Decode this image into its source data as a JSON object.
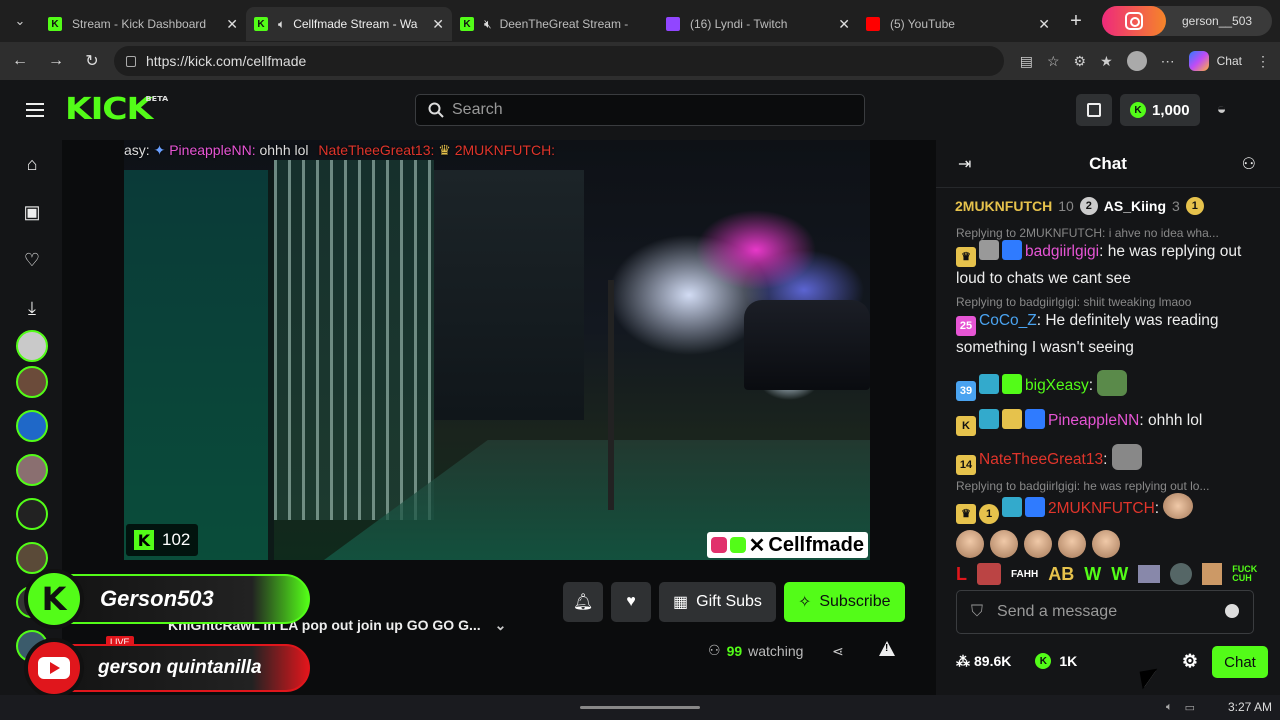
{
  "browser": {
    "tabs": [
      {
        "label": "Stream - Kick Dashboard",
        "favicon": "kick-icon",
        "color": "#53fc18",
        "active": false
      },
      {
        "label": "Cellfmade Stream - Wa",
        "favicon": "kick-icon",
        "color": "#53fc18",
        "active": true
      },
      {
        "label": "DeenTheGreat Stream -",
        "favicon": "kick-icon",
        "color": "#53fc18",
        "active": false
      },
      {
        "label": "(16) Lyndi - Twitch",
        "favicon": "twitch-icon",
        "color": "#9146ff",
        "active": false
      },
      {
        "label": "(5) YouTube",
        "favicon": "youtube-icon",
        "color": "#ff0000",
        "active": false
      }
    ],
    "profile_name": "gerson__503",
    "url": "https://kick.com/cellfmade",
    "copilot_label": "Chat"
  },
  "kick": {
    "logo": "KICK",
    "logo_beta": "BETA",
    "search_placeholder": "Search",
    "points": "1,000",
    "accent": "#53fc18"
  },
  "video": {
    "overlay_chat": {
      "lead": "asy:",
      "name1": "PineappleNN:",
      "text1": "ohhh lol",
      "name2": "NateTheeGreat13:",
      "name3": "2MUKNFUTCH:"
    },
    "viewer_count": "102",
    "watermark": "Cellfmade"
  },
  "stream": {
    "title": "KniGhtcRawL in LA pop out join up GO GO G...",
    "gift_label": "Gift Subs",
    "subscribe_label": "Subscribe",
    "watching_count": "99",
    "watching_label": "watching",
    "live_label": "LIVE"
  },
  "overlays": {
    "kick_name": "Gerson503",
    "youtube_name": "gerson quintanilla"
  },
  "chat": {
    "title": "Chat",
    "pinned": [
      {
        "name": "2MUKNFUTCH",
        "count": "10"
      },
      {
        "name": "AS_Kiing",
        "count": "3",
        "rank": "2"
      },
      {
        "rank": "1"
      }
    ],
    "messages": [
      {
        "reply": "Replying to 2MUKNFUTCH: i ahve no idea wha...",
        "user": "badgiirlgigi",
        "color": "#e655d4",
        "text": "he was replying out loud to chats we cant see"
      },
      {
        "reply": "Replying to badgiirlgigi: shiit tweaking lmaoo",
        "user": "CoCo_Z",
        "color": "#4aa3f0",
        "badge": "25",
        "text": "He definitely was reading something I wasn't seeing"
      },
      {
        "user": "bigXeasy",
        "color": "#53fc18",
        "badge": "39",
        "text": ""
      },
      {
        "user": "PineappleNN",
        "color": "#e655d4",
        "text": "ohhh lol"
      },
      {
        "user": "NateTheeGreat13",
        "color": "#e0352b",
        "badge": "14",
        "text": ""
      },
      {
        "reply": "Replying to badgiirlgigi: he was replying out lo...",
        "user": "2MUKNFUTCH",
        "color": "#e0352b",
        "text": ""
      }
    ],
    "emote_bar": [
      "L",
      "FAHH",
      "AB",
      "W",
      "W",
      "FUCK CUH"
    ],
    "input_placeholder": "Send a message",
    "followers": "89.6K",
    "points": "1K",
    "send_label": "Chat"
  },
  "taskbar": {
    "time": "3:27 AM"
  }
}
